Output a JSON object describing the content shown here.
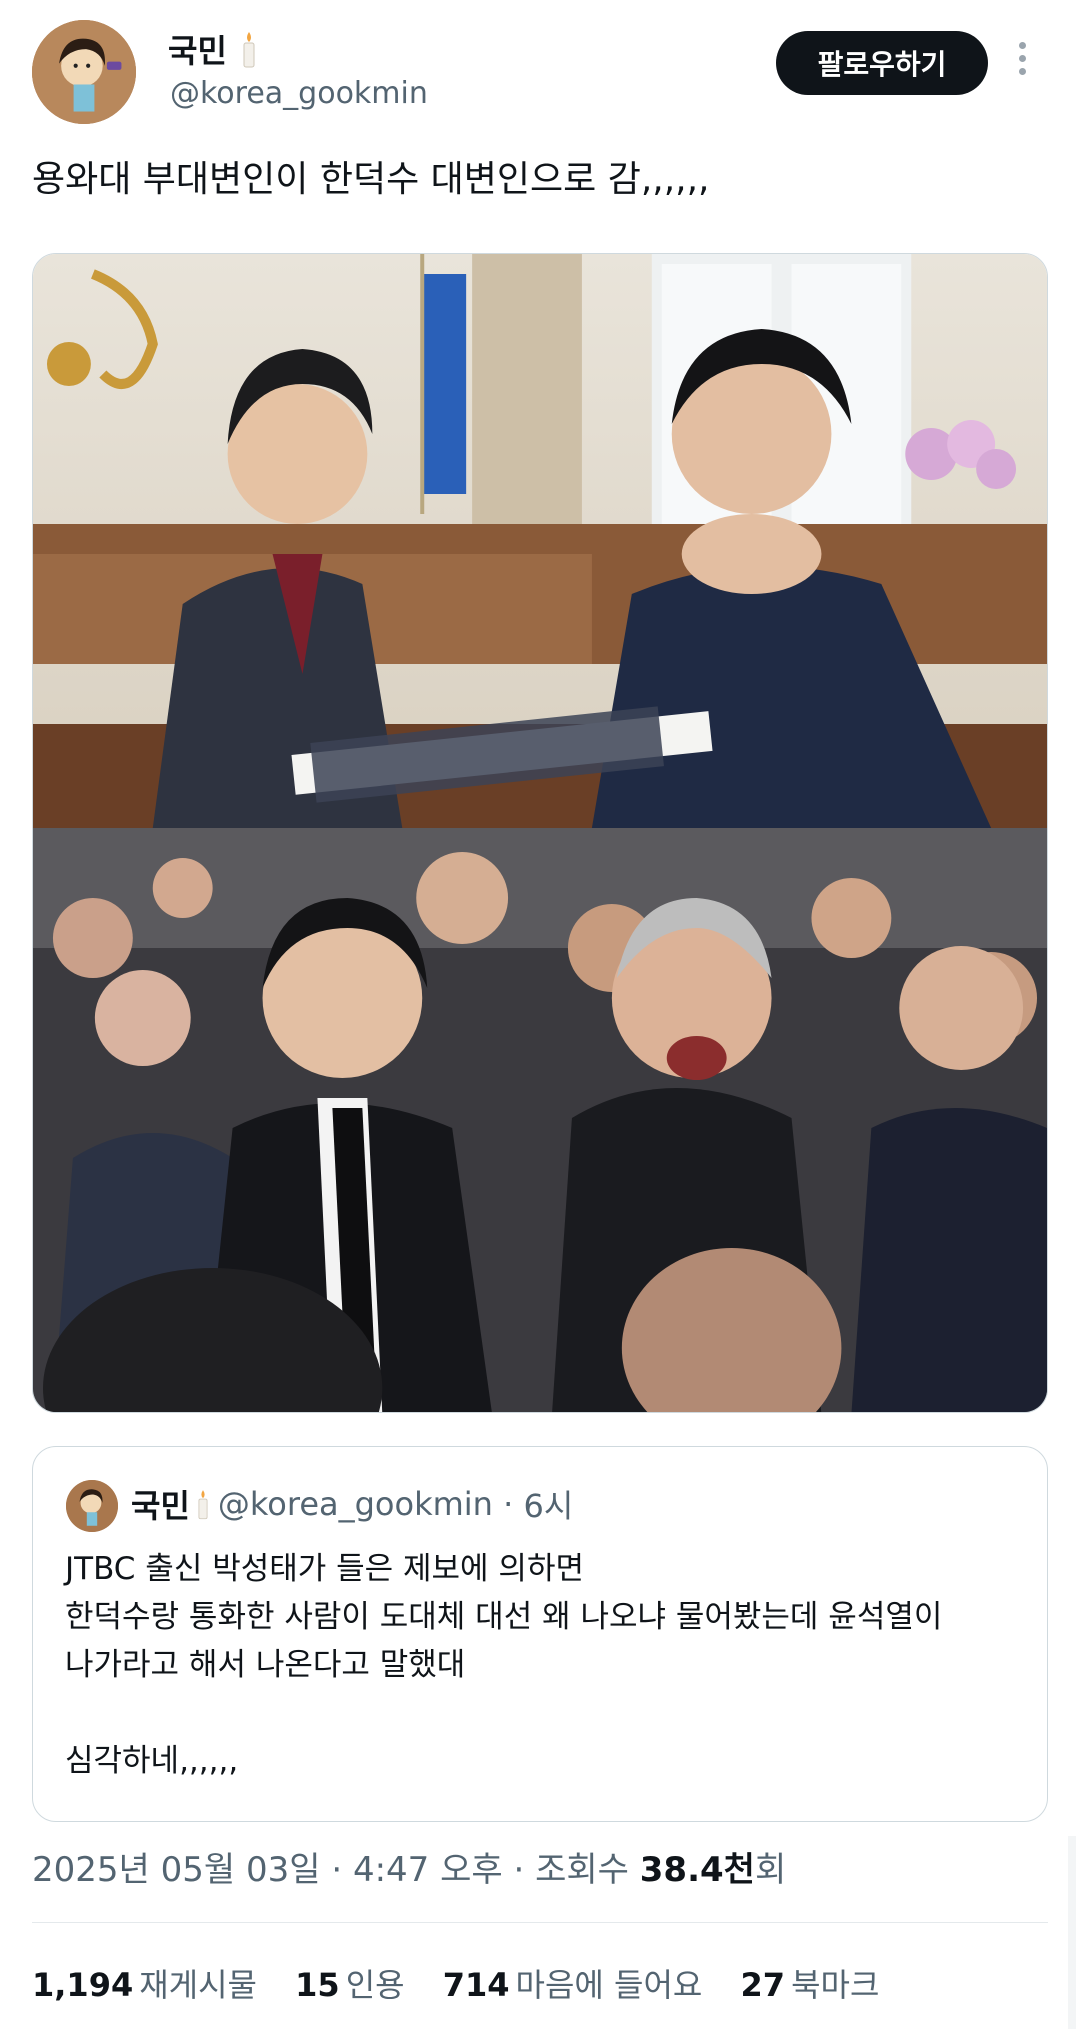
{
  "author": {
    "name": "국민",
    "handle": "@korea_gookmin",
    "name_icon": "candle-icon"
  },
  "header": {
    "follow_label": "팔로우하기",
    "more_icon": "more-vertical-icon"
  },
  "tweet": {
    "text": "용와대 부대변인이 한덕수 대변인으로 감,,,,,,"
  },
  "quote": {
    "name": "국민",
    "handle": "@korea_gookmin",
    "separator": "·",
    "time": "6시",
    "lines": [
      "JTBC 출신 박성태가 들은 제보에 의하면",
      "한덕수랑 통화한 사람이 도대체 대선 왜 나오냐 물어봤는데 윤석열이",
      "나가라고 해서 나온다고 말했대",
      "",
      "심각하네,,,,,,"
    ]
  },
  "meta": {
    "date": "2025년 05월 03일",
    "sep1": "·",
    "time": "4:47 오후",
    "sep2": "·",
    "views_label": "조회수",
    "views_value": "38.4천",
    "views_suffix": "회"
  },
  "stats": [
    {
      "value": "1,194",
      "label": "재게시물"
    },
    {
      "value": "15",
      "label": "인용"
    },
    {
      "value": "714",
      "label": "마음에 들어요"
    },
    {
      "value": "27",
      "label": "북마크"
    }
  ],
  "colors": {
    "text": "#0f1419",
    "muted": "#536471",
    "border": "#cfd9de",
    "button_bg": "#0f1419"
  }
}
